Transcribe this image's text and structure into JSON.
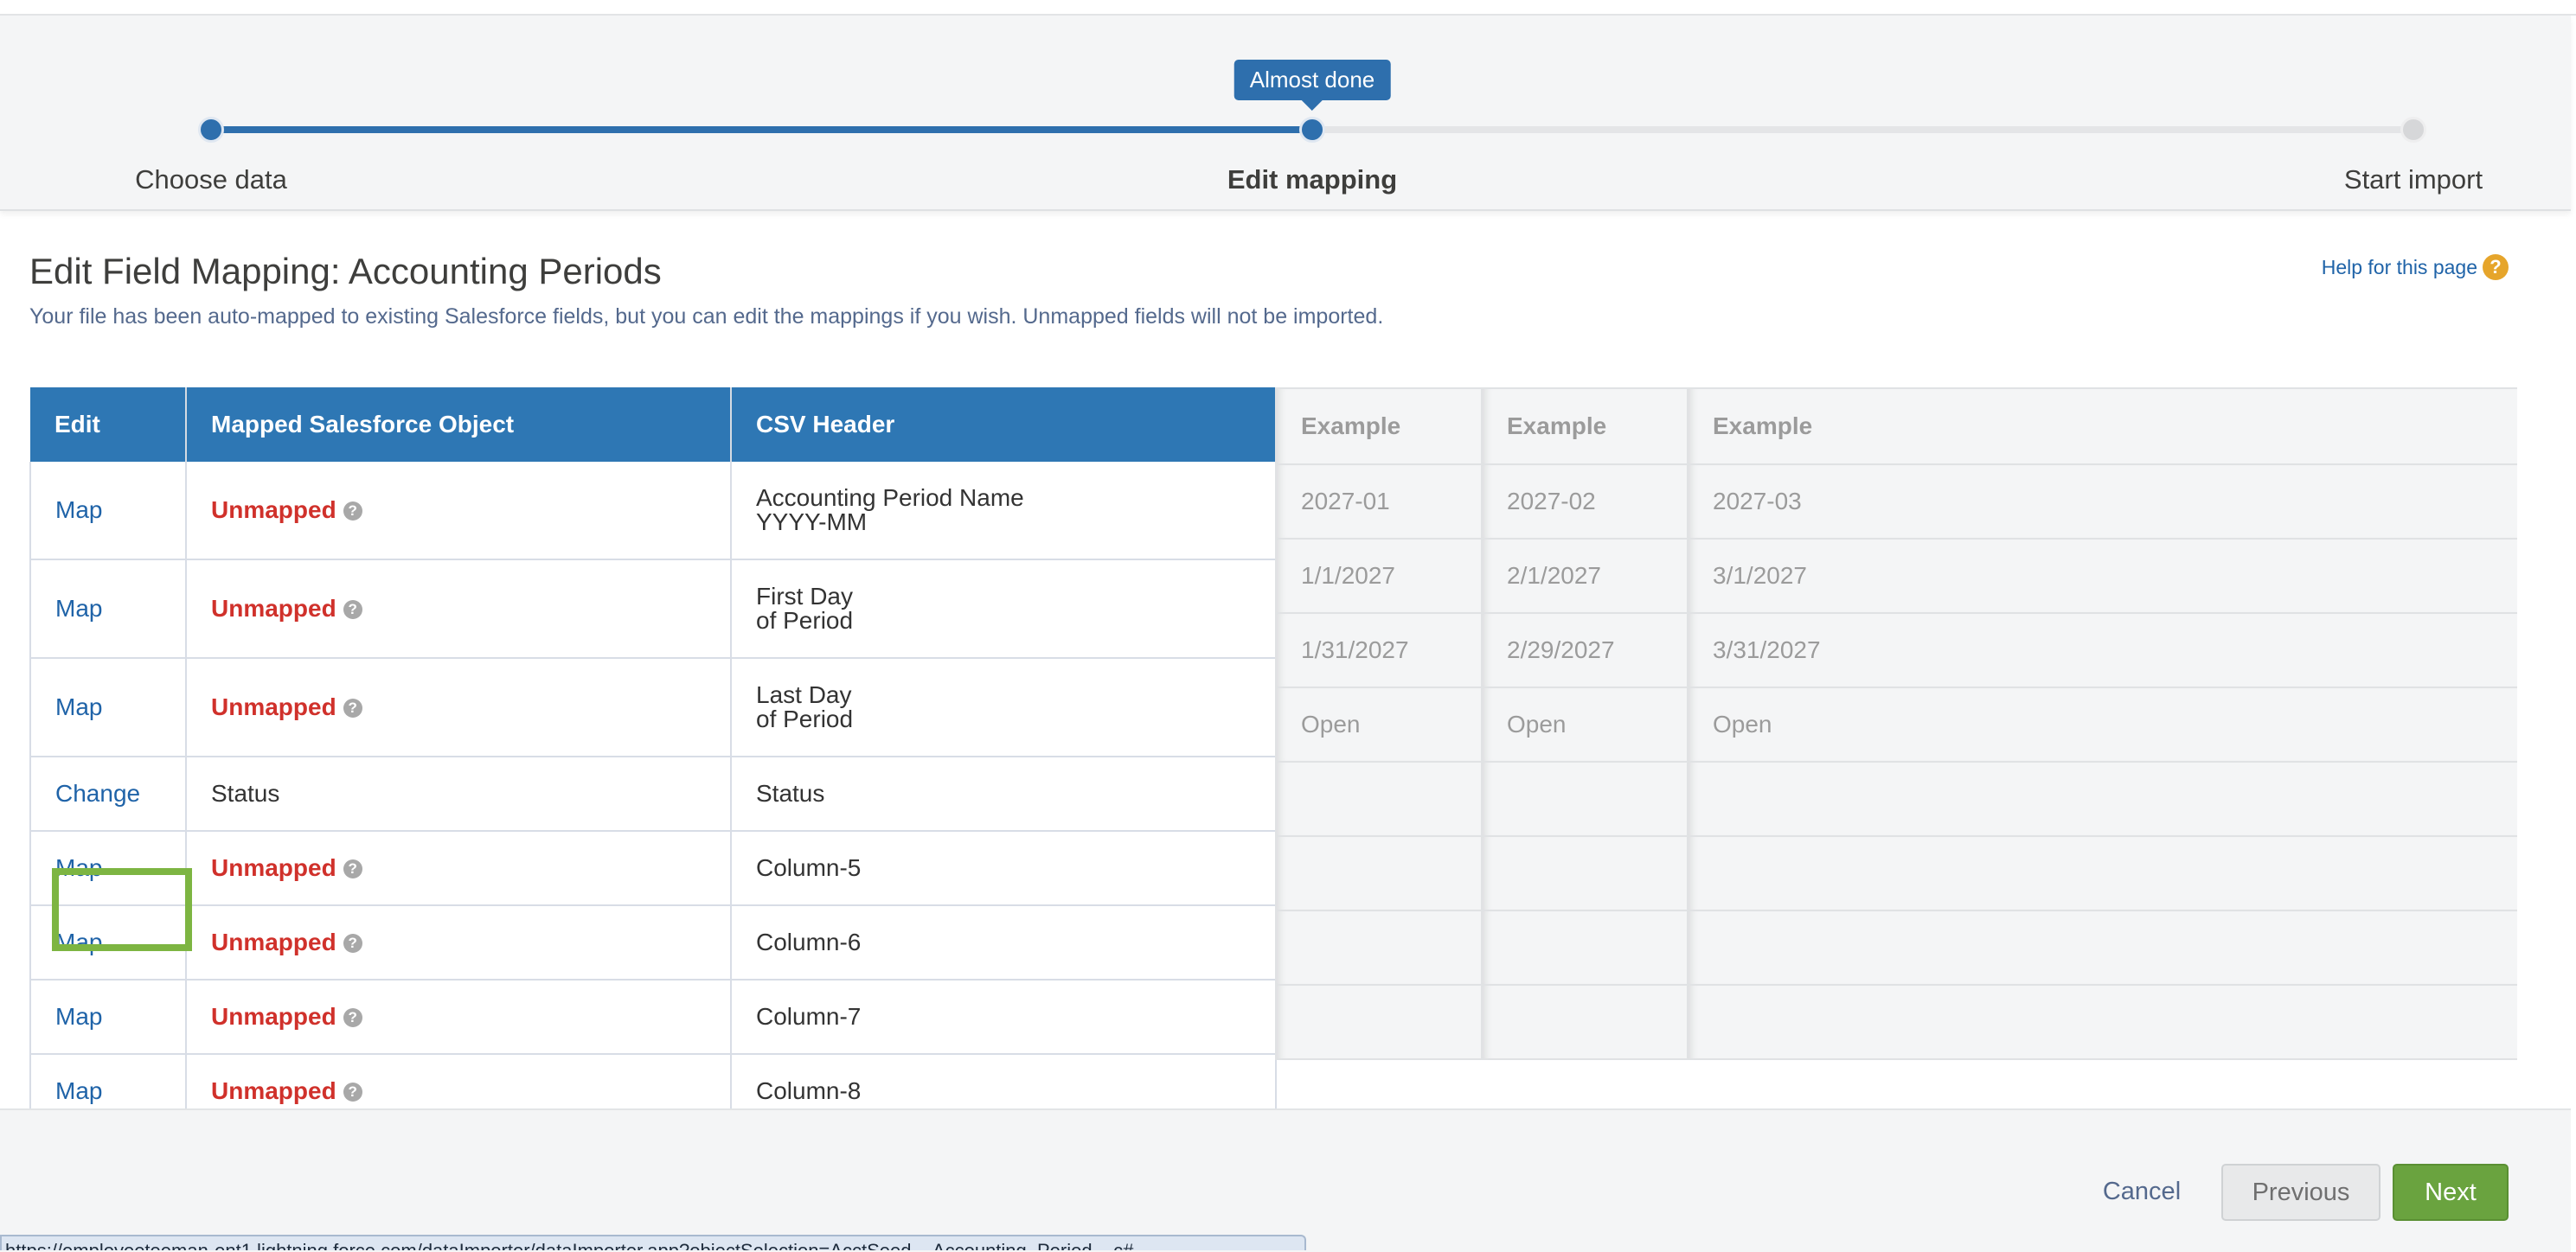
{
  "wizard": {
    "tooltip": "Almost done",
    "progress_fraction": 0.5,
    "steps": [
      {
        "label": "Choose data",
        "state": "done"
      },
      {
        "label": "Edit mapping",
        "state": "current"
      },
      {
        "label": "Start import",
        "state": "todo"
      }
    ]
  },
  "header": {
    "title": "Edit Field Mapping: Accounting Periods",
    "subtitle": "Your file has been auto-mapped to existing Salesforce fields, but you can edit the mappings if you wish. Unmapped fields will not be imported.",
    "help_link": "Help for this page",
    "help_icon": "?"
  },
  "table": {
    "headers": {
      "edit": "Edit",
      "mapped": "Mapped Salesforce Object",
      "csv": "CSV Header",
      "example1": "Example",
      "example2": "Example",
      "example3": "Example"
    },
    "rows": [
      {
        "edit": "Map",
        "mapped": "Unmapped",
        "csv1": "Accounting Period Name",
        "csv2": "YYYY-MM",
        "ex1": "2027-01",
        "ex2": "2027-02",
        "ex3": "2027-03"
      },
      {
        "edit": "Map",
        "mapped": "Unmapped",
        "csv1": "First Day",
        "csv2": "of Period",
        "ex1": "1/1/2027",
        "ex2": "2/1/2027",
        "ex3": "3/1/2027"
      },
      {
        "edit": "Map",
        "mapped": "Unmapped",
        "csv1": "Last Day",
        "csv2": "of Period",
        "ex1": "1/31/2027",
        "ex2": "2/29/2027",
        "ex3": "3/31/2027"
      },
      {
        "edit": "Change",
        "mapped": "Status",
        "csv1": "Status",
        "csv2": "",
        "ex1": "Open",
        "ex2": "Open",
        "ex3": "Open"
      },
      {
        "edit": "Map",
        "mapped": "Unmapped",
        "csv1": "Column-5",
        "csv2": "",
        "ex1": "",
        "ex2": "",
        "ex3": ""
      },
      {
        "edit": "Map",
        "mapped": "Unmapped",
        "csv1": "Column-6",
        "csv2": "",
        "ex1": "",
        "ex2": "",
        "ex3": ""
      },
      {
        "edit": "Map",
        "mapped": "Unmapped",
        "csv1": "Column-7",
        "csv2": "",
        "ex1": "",
        "ex2": "",
        "ex3": ""
      },
      {
        "edit": "Map",
        "mapped": "Unmapped",
        "csv1": "Column-8",
        "csv2": "",
        "ex1": "",
        "ex2": "",
        "ex3": ""
      }
    ]
  },
  "footer": {
    "cancel": "Cancel",
    "previous": "Previous",
    "next": "Next"
  },
  "status_bar": {
    "url": "https://employeeteeman-ent1.lightning.force.com/dataImporter/dataImporter.app?objectSelection=AcctSeed__Accounting_Period__c#"
  },
  "colors": {
    "accent": "#2e6fad",
    "header_blue": "#2e77b4",
    "unmapped_red": "#d0312b",
    "next_green": "#6aa33f",
    "focus_green": "#7db542",
    "help_orange": "#e6a52b"
  }
}
